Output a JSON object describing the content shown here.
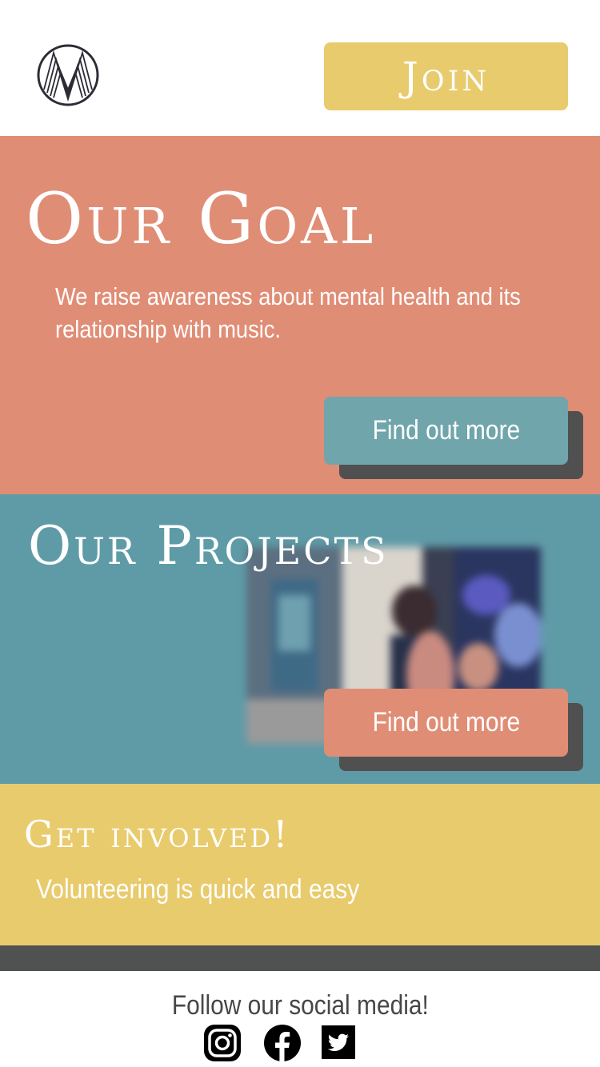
{
  "header": {
    "join_label": "Join"
  },
  "goal": {
    "title": "Our Goal",
    "text": "We raise awareness about mental health and its relationship with music.",
    "button_label": "Find out more"
  },
  "projects": {
    "title": "Our Projects",
    "button_label": "Find out more"
  },
  "involved": {
    "title": "Get involved!",
    "text": "Volunteering is quick and easy"
  },
  "footer": {
    "social_title": "Follow our social media!",
    "icons": [
      "instagram-icon",
      "facebook-icon",
      "twitter-icon"
    ]
  },
  "colors": {
    "coral": "#e08d75",
    "teal": "#5f9ba7",
    "teal_button": "#6fa5ab",
    "yellow": "#e8cb6d",
    "dark": "#505252"
  }
}
